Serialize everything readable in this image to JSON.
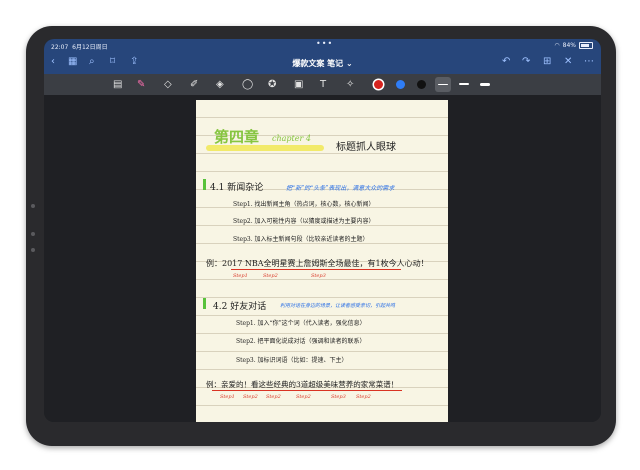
{
  "status": {
    "time": "22:07",
    "date": "6月12日周日",
    "battery": "84%"
  },
  "nav": {
    "title": "爆款文案 笔记",
    "title_caret": "⌄"
  },
  "toolbar": {
    "colors": {
      "red": "#d6231e",
      "blue": "#2f7df6",
      "black": "#111111",
      "selected_bg": "#5a5d63"
    }
  },
  "note": {
    "chapter_cn": "第四章",
    "chapter_en": "chapter 4",
    "chapter_title": "标题抓人眼球",
    "s41_num": "4.1",
    "s41_title": "新闻杂论",
    "s41_note": "把“新”的“头条”表现出，满意大众的需求",
    "s41_step1": "Step1. 找出新闻主角（热点词，核心数，核心新闻）",
    "s41_step2": "Step2. 加入可能性内容（以猜度或描述为主要内容）",
    "s41_step3": "Step3. 加入标主新闻句段（比较亲近读者的主题）",
    "s41_example": "例：2017 NBA全明星赛上詹姆斯全场最佳，有1枚今人心动！",
    "s41_steps_red": [
      "Step1",
      "Step2",
      "Step3"
    ],
    "s42_num": "4.2",
    "s42_title": "好友对话",
    "s42_note": "利用对话在身边的场景，让读者感受亲切，引起共鸣",
    "s42_step1": "Step1. 加入“你”这个词（代入读者，强化信息）",
    "s42_step2": "Step2. 把平面化说成对话（强调和读者的联系）",
    "s42_step3": "Step3. 加标识词语（比如：提速、下主）",
    "s42_example": "例：亲爱的！看这些经典的3道超级美味营养的家常菜谱！",
    "s42_steps_red": [
      "Step1",
      "Step2",
      "Step2",
      "Step2",
      "Step3",
      "Step2"
    ]
  }
}
